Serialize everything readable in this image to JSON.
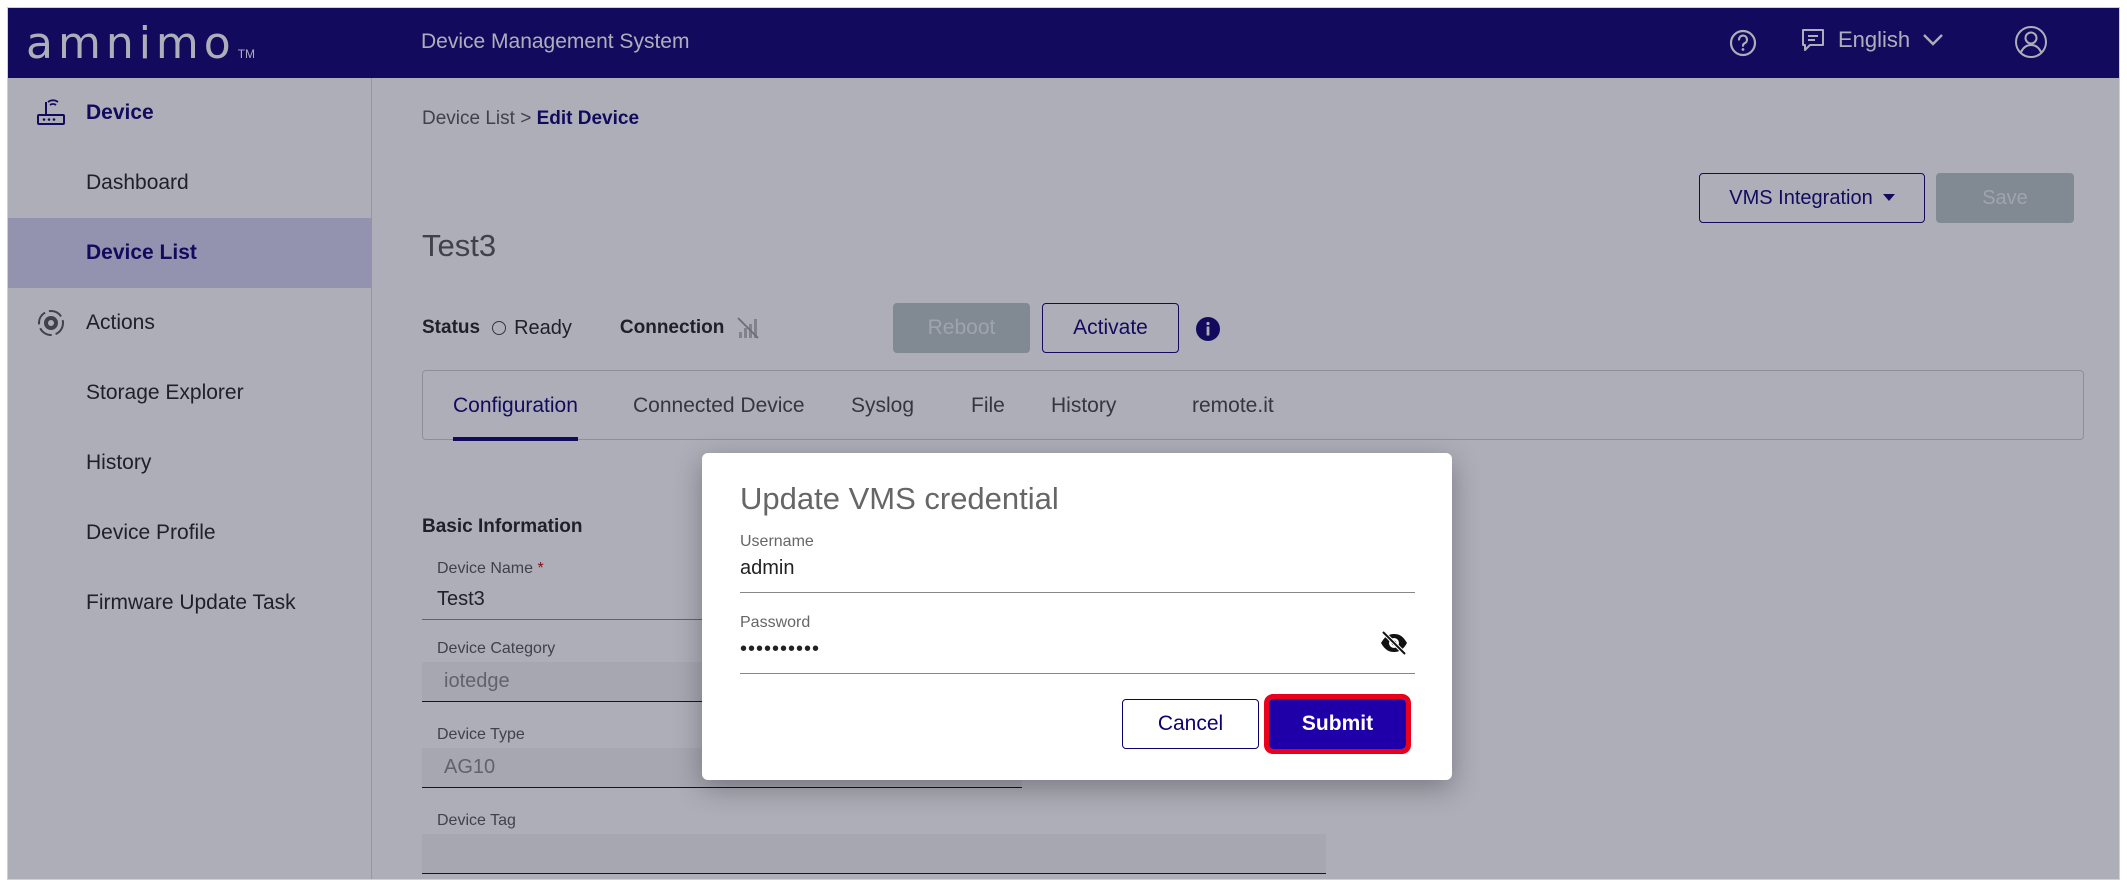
{
  "header": {
    "logo_text": "amnimo",
    "logo_tm": "TM",
    "app_title": "Device Management System",
    "language": "English",
    "help_icon": "help-circle-icon",
    "language_icon": "chat-bubble-icon",
    "user_icon": "user-circle-icon"
  },
  "sidebar": {
    "items": [
      {
        "label": "Device",
        "icon": "router-icon"
      },
      {
        "label": "Dashboard"
      },
      {
        "label": "Device List"
      },
      {
        "label": "Actions",
        "icon": "gear-cycle-icon"
      },
      {
        "label": "Storage Explorer"
      },
      {
        "label": "History"
      },
      {
        "label": "Device Profile"
      },
      {
        "label": "Firmware Update Task"
      }
    ]
  },
  "main": {
    "breadcrumb": {
      "parent": "Device List",
      "separator": " > ",
      "current": "Edit Device"
    },
    "vms_integration_label": "VMS Integration",
    "save_label": "Save",
    "device_name_title": "Test3",
    "status": {
      "label": "Status",
      "value": "Ready"
    },
    "connection": {
      "label": "Connection"
    },
    "reboot_label": "Reboot",
    "activate_label": "Activate",
    "tabs": [
      {
        "label": "Configuration"
      },
      {
        "label": "Connected Device"
      },
      {
        "label": "Syslog"
      },
      {
        "label": "File"
      },
      {
        "label": "History"
      },
      {
        "label": "remote.it"
      }
    ],
    "basic_information": "Basic Information",
    "fields": {
      "device_name": {
        "label": "Device Name",
        "required_mark": "*",
        "value": "Test3"
      },
      "device_category": {
        "label": "Device Category",
        "value": "iotedge"
      },
      "device_type": {
        "label": "Device Type",
        "value": "AG10"
      },
      "device_tag": {
        "label": "Device Tag",
        "value": ""
      }
    }
  },
  "dialog": {
    "title": "Update VMS credential",
    "username": {
      "label": "Username",
      "value": "admin"
    },
    "password": {
      "label": "Password",
      "value": "••••••••••"
    },
    "cancel_label": "Cancel",
    "submit_label": "Submit"
  },
  "colors": {
    "brand_navy": "#0c0070",
    "submit_blue": "#1f00a8",
    "highlight_red": "#e8001c",
    "disabled_button": "#b9c7c3",
    "active_nav_bg": "#d6d5f0"
  }
}
